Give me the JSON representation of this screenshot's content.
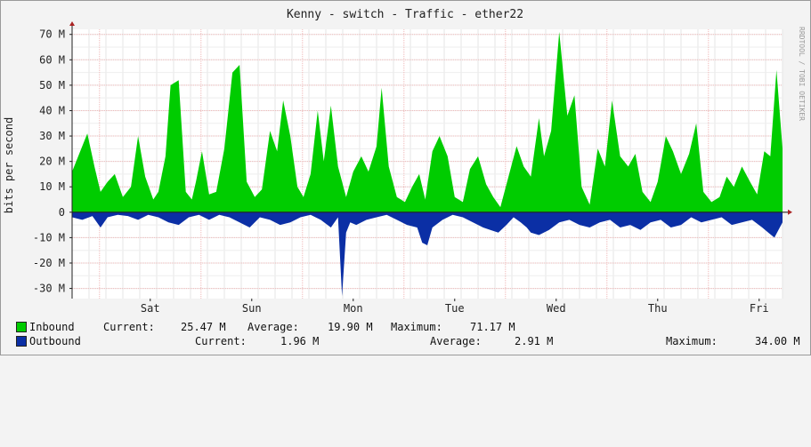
{
  "chart_data": {
    "type": "area",
    "title": "Kenny - switch - Traffic - ether22",
    "ylabel": "bits per second",
    "side_label": "RRDTOOL / TOBI OETIKER",
    "ylim": [
      -34,
      72
    ],
    "y_ticks": [
      -30,
      -20,
      -10,
      0,
      10,
      20,
      30,
      40,
      50,
      60,
      70
    ],
    "y_tick_labels": [
      "-30 M",
      "-20 M",
      "-10 M",
      "0",
      "10 M",
      "20 M",
      "30 M",
      "40 M",
      "50 M",
      "60 M",
      "70 M"
    ],
    "x_unit": "days since start of graph",
    "xlim": [
      0,
      7
    ],
    "x_ticks": [
      0.77,
      1.77,
      2.77,
      3.77,
      4.77,
      5.77,
      6.77
    ],
    "x_tick_labels": [
      "Sat",
      "Sun",
      "Mon",
      "Tue",
      "Wed",
      "Thu",
      "Fri"
    ],
    "grid": true,
    "series": [
      {
        "name": "Inbound",
        "color": "#00cc00",
        "x": [
          0,
          0.08,
          0.15,
          0.22,
          0.28,
          0.35,
          0.42,
          0.5,
          0.58,
          0.65,
          0.72,
          0.8,
          0.85,
          0.92,
          0.97,
          1.05,
          1.12,
          1.18,
          1.22,
          1.28,
          1.35,
          1.42,
          1.5,
          1.58,
          1.65,
          1.72,
          1.8,
          1.87,
          1.95,
          2.02,
          2.08,
          2.15,
          2.22,
          2.28,
          2.35,
          2.42,
          2.48,
          2.55,
          2.62,
          2.7,
          2.77,
          2.85,
          2.92,
          3,
          3.05,
          3.12,
          3.2,
          3.28,
          3.35,
          3.42,
          3.48,
          3.55,
          3.62,
          3.7,
          3.77,
          3.85,
          3.92,
          4,
          4.08,
          4.15,
          4.22,
          4.3,
          4.38,
          4.45,
          4.52,
          4.6,
          4.65,
          4.72,
          4.8,
          4.88,
          4.95,
          5.02,
          5.1,
          5.18,
          5.25,
          5.32,
          5.4,
          5.48,
          5.55,
          5.62,
          5.7,
          5.77,
          5.85,
          5.92,
          6,
          6.08,
          6.15,
          6.22,
          6.3,
          6.38,
          6.45,
          6.52,
          6.6,
          6.68,
          6.75,
          6.82,
          6.88,
          6.94,
          7
        ],
        "values": [
          16,
          24,
          31,
          18,
          8,
          12,
          15,
          6,
          10,
          30,
          14,
          5,
          8,
          22,
          50,
          52,
          8,
          5,
          12,
          24,
          7,
          8,
          25,
          55,
          58,
          12,
          6,
          9,
          32,
          24,
          44,
          30,
          10,
          6,
          15,
          40,
          20,
          42,
          18,
          6,
          16,
          22,
          16,
          26,
          49,
          18,
          6,
          4,
          10,
          15,
          5,
          24,
          30,
          22,
          6,
          4,
          17,
          22,
          11,
          6,
          2,
          14,
          26,
          18,
          14,
          37,
          22,
          32,
          71,
          38,
          46,
          10,
          3,
          25,
          18,
          44,
          22,
          18,
          23,
          8,
          4,
          12,
          30,
          24,
          15,
          23,
          35,
          8,
          4,
          6,
          14,
          10,
          18,
          12,
          7,
          24,
          22,
          56,
          25
        ]
      },
      {
        "name": "Outbound",
        "color": "#0b2fa5",
        "x": [
          0,
          0.1,
          0.2,
          0.28,
          0.35,
          0.45,
          0.55,
          0.65,
          0.75,
          0.85,
          0.95,
          1.05,
          1.15,
          1.25,
          1.35,
          1.45,
          1.55,
          1.65,
          1.75,
          1.85,
          1.95,
          2.05,
          2.15,
          2.25,
          2.35,
          2.45,
          2.55,
          2.62,
          2.66,
          2.7,
          2.74,
          2.8,
          2.9,
          3,
          3.1,
          3.2,
          3.3,
          3.4,
          3.45,
          3.5,
          3.55,
          3.65,
          3.75,
          3.85,
          3.95,
          4.05,
          4.12,
          4.2,
          4.28,
          4.35,
          4.42,
          4.48,
          4.52,
          4.6,
          4.7,
          4.8,
          4.9,
          5,
          5.1,
          5.2,
          5.3,
          5.4,
          5.5,
          5.6,
          5.7,
          5.8,
          5.9,
          6,
          6.1,
          6.2,
          6.3,
          6.4,
          6.5,
          6.6,
          6.7,
          6.8,
          6.86,
          6.92,
          7
        ],
        "values": [
          -2,
          -3,
          -1.5,
          -6,
          -2,
          -1,
          -1.5,
          -3,
          -1,
          -2,
          -4,
          -5,
          -2,
          -1,
          -3,
          -1,
          -2,
          -4,
          -6,
          -2,
          -3,
          -5,
          -4,
          -2,
          -1,
          -3,
          -6,
          -2,
          -33,
          -8,
          -4,
          -5,
          -3,
          -2,
          -1,
          -3,
          -5,
          -6,
          -12,
          -13,
          -6,
          -3,
          -1,
          -2,
          -4,
          -6,
          -7,
          -8,
          -5,
          -2,
          -4,
          -6,
          -8,
          -9,
          -7,
          -4,
          -3,
          -5,
          -6,
          -4,
          -3,
          -6,
          -5,
          -7,
          -4,
          -3,
          -6,
          -5,
          -2,
          -4,
          -3,
          -2,
          -5,
          -4,
          -3,
          -6,
          -8,
          -10,
          -4
        ]
      }
    ]
  },
  "legend": {
    "inbound": {
      "label": "Inbound",
      "current_label": "Current:",
      "current": "25.47 M",
      "average_label": "Average:",
      "average": "19.90 M",
      "maximum_label": "Maximum:",
      "maximum": "71.17 M",
      "color": "#00cc00"
    },
    "outbound": {
      "label": "Outbound",
      "current_label": "Current:",
      "current": "1.96 M",
      "average_label": "Average:",
      "average": "2.91 M",
      "maximum_label": "Maximum:",
      "maximum": "34.00 M",
      "color": "#0b2fa5"
    }
  }
}
